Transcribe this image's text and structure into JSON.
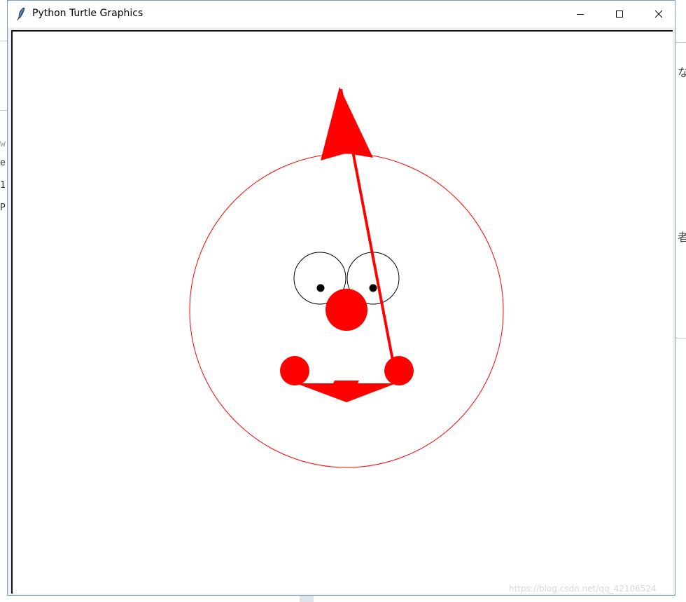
{
  "window": {
    "title": "Python Turtle Graphics"
  },
  "icons": {
    "app": "feather-icon",
    "minimize": "minimize-icon",
    "maximize": "maximize-icon",
    "close": "close-icon"
  },
  "background_app": {
    "left_fragments": [
      "w",
      "e",
      "1",
      "P"
    ],
    "right_fragments": [
      "な",
      "者"
    ]
  },
  "drawing": {
    "outline_color": "#ff0000",
    "fill_color": "#ff0000",
    "eye_color": "#000000",
    "parts": [
      "face-circle",
      "left-eye",
      "right-eye",
      "left-pupil",
      "right-pupil",
      "nose",
      "left-cheek",
      "right-cheek",
      "mouth",
      "hat-arrow",
      "pen-line"
    ]
  },
  "watermark": "https://blog.csdn.net/qq_42106524"
}
